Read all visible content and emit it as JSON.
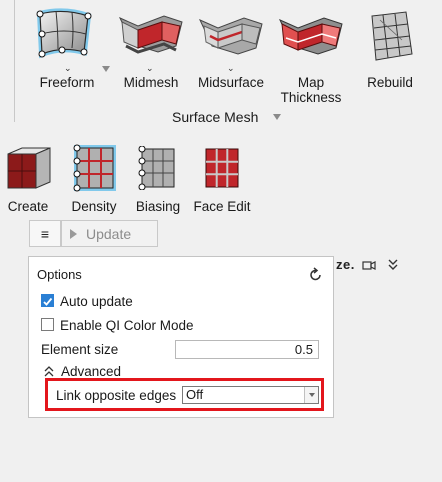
{
  "ribbon": {
    "tools": [
      {
        "label": "Freeform",
        "icon": "freeform-surface-icon",
        "active": true
      },
      {
        "label": "Midmesh",
        "icon": "midmesh-icon"
      },
      {
        "label": "Midsurface",
        "icon": "midsurface-icon"
      },
      {
        "label": "Map\nThickness",
        "label_line1": "Map",
        "label_line2": "Thickness",
        "icon": "map-thickness-icon"
      },
      {
        "label": "Rebuild",
        "icon": "rebuild-mesh-icon"
      }
    ],
    "group_title": "Surface Mesh"
  },
  "mesh_tools": [
    {
      "label": "Create",
      "icon": "create-mesh-icon"
    },
    {
      "label": "Density",
      "icon": "density-icon",
      "active": true
    },
    {
      "label": "Biasing",
      "icon": "biasing-icon"
    },
    {
      "label": "Face Edit",
      "icon": "face-edit-icon"
    }
  ],
  "toolbar": {
    "menu_glyph": "≡",
    "update_label": "Update"
  },
  "behind_panel_text": "ze.",
  "options": {
    "title": "Options",
    "auto_update": {
      "label": "Auto update",
      "checked": true
    },
    "enable_qi": {
      "label": "Enable QI Color Mode",
      "checked": false
    },
    "element_size": {
      "label": "Element size",
      "value": "0.5"
    },
    "advanced": {
      "label": "Advanced"
    },
    "link_opposite_edges": {
      "label": "Link opposite edges",
      "value": "Off"
    }
  },
  "colors": {
    "highlight": "#e3161c",
    "active_glow": "#27a9e8",
    "checkbox": "#2a7fd4",
    "mesh_red": "#c0262b"
  }
}
